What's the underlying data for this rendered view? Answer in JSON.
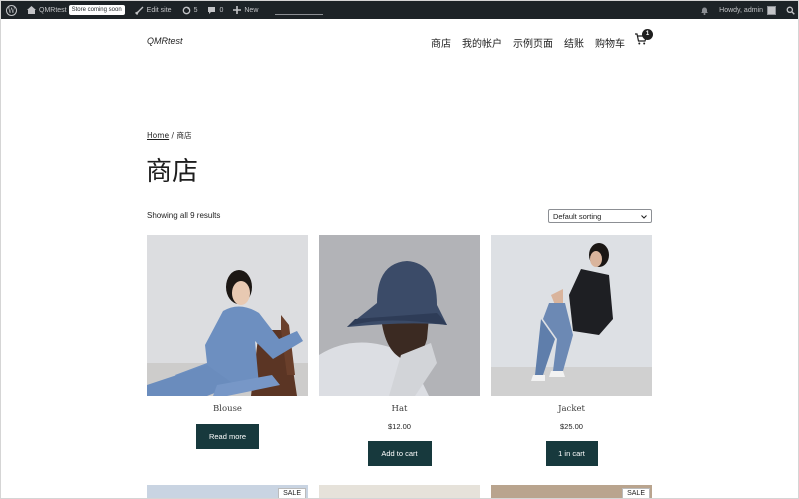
{
  "admin_bar": {
    "site_name": "QMRtest",
    "store_badge": "Store coming soon",
    "edit_site": "Edit site",
    "updates_count": "5",
    "comments_count": "0",
    "new_label": "New",
    "greeting": "Howdy, admin"
  },
  "header": {
    "site_title": "QMRtest",
    "nav": [
      "商店",
      "我的帐户",
      "示例页面",
      "结账",
      "购物车"
    ],
    "cart_count": "1"
  },
  "breadcrumb": {
    "home": "Home",
    "separator": "/",
    "current": "商店"
  },
  "page_title": "商店",
  "result_count": "Showing all 9 results",
  "sorting": {
    "selected": "Default sorting"
  },
  "products": [
    {
      "name": "Blouse",
      "price": "",
      "button": "Read more"
    },
    {
      "name": "Hat",
      "price": "$12.00",
      "button": "Add to cart"
    },
    {
      "name": "Jacket",
      "price": "$25.00",
      "button": "1 in cart"
    }
  ],
  "row2": {
    "sale_label": "SALE"
  },
  "colors": {
    "admin_bar": "#1d2327",
    "button": "#17393d"
  }
}
